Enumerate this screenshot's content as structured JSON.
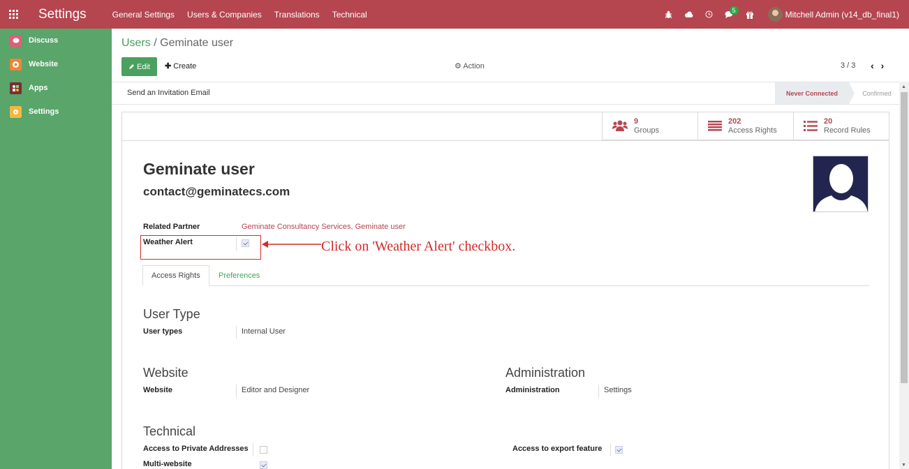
{
  "topbar": {
    "app_title": "Settings",
    "menu": [
      "General Settings",
      "Users & Companies",
      "Translations",
      "Technical"
    ],
    "message_count": "5",
    "user": "Mitchell Admin (v14_db_final1)",
    "bg_color": "#b5454f"
  },
  "sidebar": {
    "items": [
      {
        "label": "Discuss",
        "icon": "chat-icon",
        "color": "#e05e77"
      },
      {
        "label": "Website",
        "icon": "globe-icon",
        "color": "#f08534"
      },
      {
        "label": "Apps",
        "icon": "apps-icon",
        "color": "#7b2e2e"
      },
      {
        "label": "Settings",
        "icon": "gear-icon",
        "color": "#f4b73f"
      }
    ],
    "bg_color": "#59a56a"
  },
  "breadcrumb": {
    "parent": "Users",
    "separator": " / ",
    "current": "Geminate user"
  },
  "toolbar": {
    "edit": "Edit",
    "create": "Create",
    "action": "Action",
    "pager": "3 / 3"
  },
  "statusbar": {
    "invite": "Send an Invitation Email",
    "stage_current": "Never Connected",
    "stage_next": "Confirmed"
  },
  "stats": [
    {
      "value": "9",
      "label": "Groups",
      "icon": "users-icon"
    },
    {
      "value": "202",
      "label": "Access Rights",
      "icon": "list-icon"
    },
    {
      "value": "20",
      "label": "Record Rules",
      "icon": "list-bullets-icon"
    }
  ],
  "user": {
    "name": "Geminate user",
    "login": "contact@geminatecs.com"
  },
  "fields": {
    "related_partner_label": "Related Partner",
    "related_partner_value": "Geminate Consultancy Services, Geminate user",
    "weather_alert_label": "Weather Alert"
  },
  "annotation": "Click on 'Weather Alert' checkbox.",
  "tabs": {
    "access_rights": "Access Rights",
    "preferences": "Preferences"
  },
  "user_type": {
    "heading": "User Type",
    "label": "User types",
    "value": "Internal User"
  },
  "website": {
    "heading": "Website",
    "label": "Website",
    "value": "Editor and Designer"
  },
  "administration": {
    "heading": "Administration",
    "label": "Administration",
    "value": "Settings"
  },
  "technical": {
    "heading": "Technical",
    "private_addresses": "Access to Private Addresses",
    "multi_website": "Multi-website",
    "export_feature": "Access to export feature"
  }
}
